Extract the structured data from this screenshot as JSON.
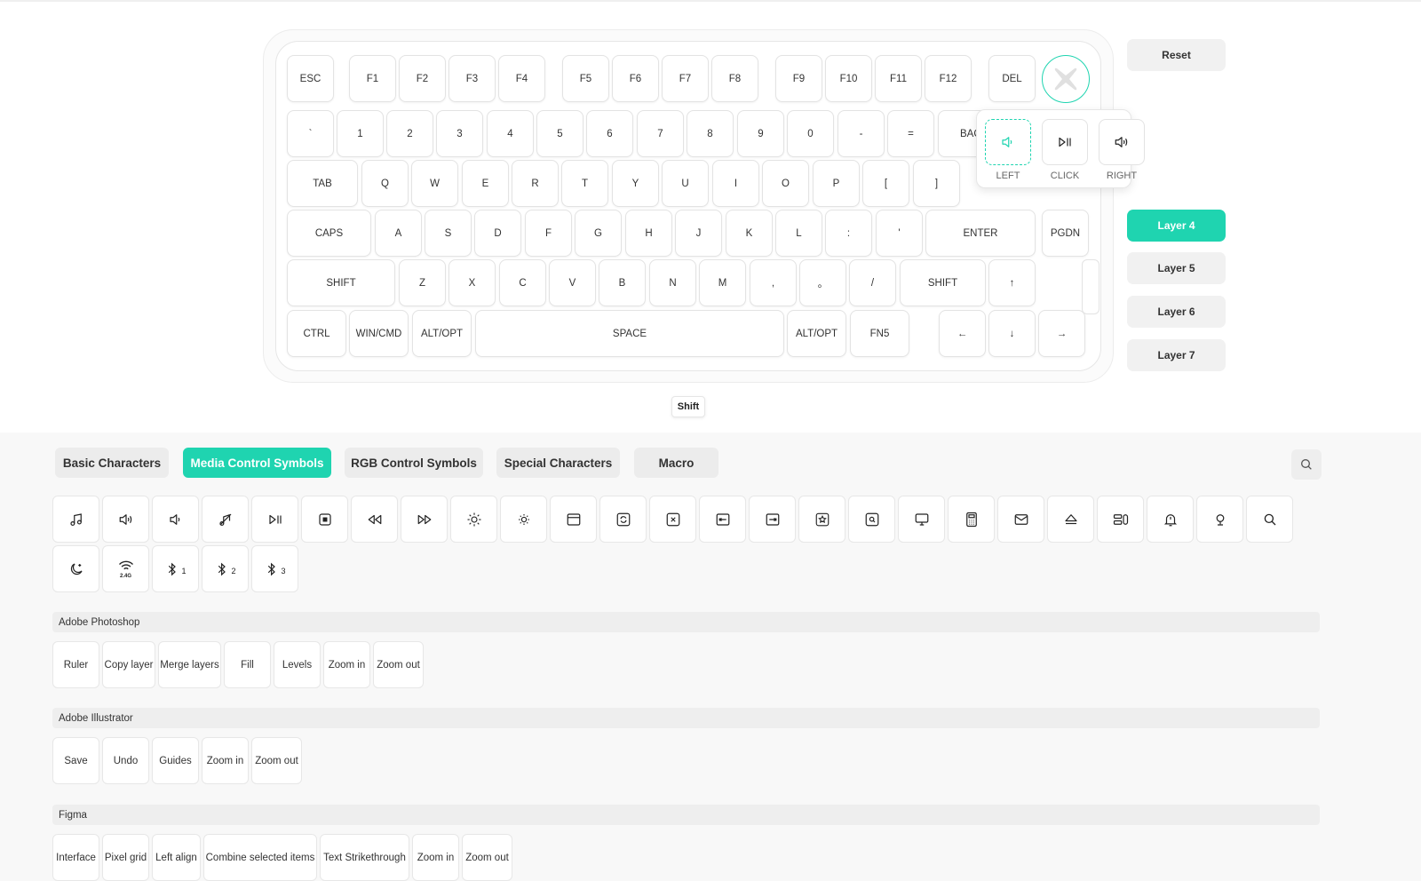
{
  "keyboard": {
    "row1": [
      "ESC",
      "F1",
      "F2",
      "F3",
      "F4",
      "F5",
      "F6",
      "F7",
      "F8",
      "F9",
      "F10",
      "F11",
      "F12",
      "DEL"
    ],
    "row2": [
      "`",
      "1",
      "2",
      "3",
      "4",
      "5",
      "6",
      "7",
      "8",
      "9",
      "0",
      "-",
      "=",
      "BAC"
    ],
    "row3": [
      "TAB",
      "Q",
      "W",
      "E",
      "R",
      "T",
      "Y",
      "U",
      "I",
      "O",
      "P",
      "[",
      "]"
    ],
    "row4": [
      "CAPS",
      "A",
      "S",
      "D",
      "F",
      "G",
      "H",
      "J",
      "K",
      "L",
      ":",
      "'",
      "ENTER",
      "PGDN"
    ],
    "row5": [
      "SHIFT",
      "Z",
      "X",
      "C",
      "V",
      "B",
      "N",
      "M",
      ",",
      "。",
      "/",
      "SHIFT",
      "↑"
    ],
    "row6": [
      "CTRL",
      "WIN/CMD",
      "ALT/OPT",
      "SPACE",
      "ALT/OPT",
      "FN5",
      "←",
      "↓",
      "→"
    ]
  },
  "knob": {
    "icon": "x-icon",
    "popup": {
      "left_label": "LEFT",
      "click_label": "CLICK",
      "right_label": "RIGHT"
    }
  },
  "sidebar": {
    "reset_label": "Reset",
    "layers": [
      "Layer 4",
      "Layer 5",
      "Layer 6",
      "Layer 7"
    ],
    "active_layer": "Layer 4"
  },
  "tooltip": {
    "shift_label": "Shift"
  },
  "tabs": {
    "items": [
      "Basic Characters",
      "Media Control Symbols",
      "RGB Control Symbols",
      "Special Characters",
      "Macro"
    ],
    "active": "Media Control Symbols"
  },
  "symbols": [
    "music-note-icon",
    "volume-up-icon",
    "volume-down-icon",
    "mute-icon",
    "play-pause-icon",
    "stop-icon",
    "rewind-icon",
    "fast-forward-icon",
    "brightness-up-icon",
    "brightness-down-icon",
    "window-icon",
    "refresh-icon",
    "close-window-icon",
    "shrink-icon",
    "expand-icon",
    "favorite-icon",
    "screen-search-icon",
    "monitor-icon",
    "calculator-icon",
    "mail-icon",
    "eject-icon",
    "toggle-icon",
    "notification-icon",
    "microphone-icon",
    "search-icon",
    "sleep-icon",
    "wireless-2.4g-icon",
    "bluetooth-1-icon",
    "bluetooth-2-icon",
    "bluetooth-3-icon"
  ],
  "symbol_texts": {
    "wireless_sub": "2.4G",
    "bt1": "1",
    "bt2": "2",
    "bt3": "3"
  },
  "sections": [
    {
      "title": "Adobe Photoshop",
      "items": [
        "Ruler",
        "Copy layer",
        "Merge layers",
        "Fill",
        "Levels",
        "Zoom in",
        "Zoom out"
      ]
    },
    {
      "title": "Adobe Illustrator",
      "items": [
        "Save",
        "Undo",
        "Guides",
        "Zoom in",
        "Zoom out"
      ]
    },
    {
      "title": "Figma",
      "items": [
        "Interface",
        "Pixel grid",
        "Left align",
        "Combine selected items",
        "Text Strikethrough",
        "Zoom in",
        "Zoom out"
      ]
    }
  ],
  "colors": {
    "accent": "#1fd4b0",
    "key_border": "#e3e3e3",
    "panel_bg": "#f8f8f8"
  }
}
